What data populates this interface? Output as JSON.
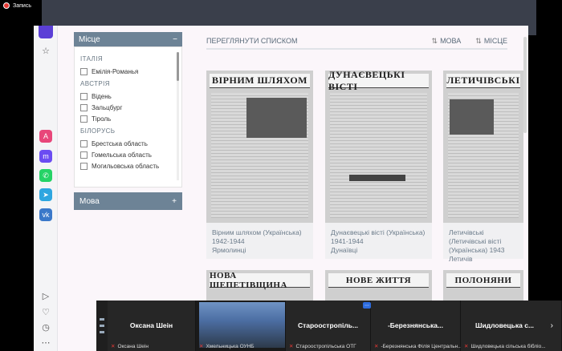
{
  "recording": {
    "label": "Запись"
  },
  "sidebar_extensions": [
    {
      "name": "aria-icon",
      "color": "#e8467a"
    },
    {
      "name": "messenger-icon",
      "color": "#6b4cf2"
    },
    {
      "name": "whatsapp-icon",
      "color": "#25d366"
    },
    {
      "name": "telegram-icon",
      "color": "#2ea6e0"
    },
    {
      "name": "vk-icon",
      "color": "#3a78c9"
    }
  ],
  "filter": {
    "header": "Місце",
    "groups": [
      {
        "title": "ІТАЛІЯ",
        "items": [
          "Емілія-Романья"
        ]
      },
      {
        "title": "АВСТРІЯ",
        "items": [
          "Відень",
          "Зальцбург",
          "Тіроль"
        ]
      },
      {
        "title": "БІЛОРУСЬ",
        "items": [
          "Брестська область",
          "Гомельська область",
          "Могильовська область"
        ]
      }
    ],
    "next_section": "Мова",
    "next_section_icon": "+"
  },
  "toolbar": {
    "list_view": "ПЕРЕГЛЯНУТИ СПИСКОМ",
    "sort_language": "МОВА",
    "sort_place": "МІСЦЕ"
  },
  "cards": [
    {
      "masthead": "ВІРНИМ ШЛЯХОМ",
      "title": "Вірним шляхом (Українська)",
      "years": "1942-1944",
      "place": "Ярмолинці"
    },
    {
      "masthead": "ДУНАЄВЕЦЬКІ ВІСТІ",
      "title": "Дунаєвецькі вісті (Українська) 1941-1944",
      "years": "",
      "place": "Дунаївці"
    },
    {
      "masthead": "ЛЕТИЧІВСЬКІ",
      "title": "Летичівські (Летичівські вісті (Українська) 1943",
      "years": "",
      "place": "Летичів"
    }
  ],
  "cards_row2": [
    {
      "masthead": "НОВА ШЕПЕТІВЩИНА"
    },
    {
      "masthead": "НОВЕ ЖИТТЯ"
    },
    {
      "masthead": "ПОЛОНЯНИ"
    }
  ],
  "participants": [
    {
      "name": "Оксана Шеін",
      "label": "Оксана Шеін"
    },
    {
      "name": "",
      "label": "Хмельницька ОУНБ"
    },
    {
      "name": "Старооcтропіль...",
      "label": "Старооcтропільська ОТГ"
    },
    {
      "name": "-Березнянська...",
      "label": "-Березнянська Філія Центральн..."
    },
    {
      "name": "Шидловецька с...",
      "label": "Шидловецька сільська бібліо..."
    }
  ]
}
